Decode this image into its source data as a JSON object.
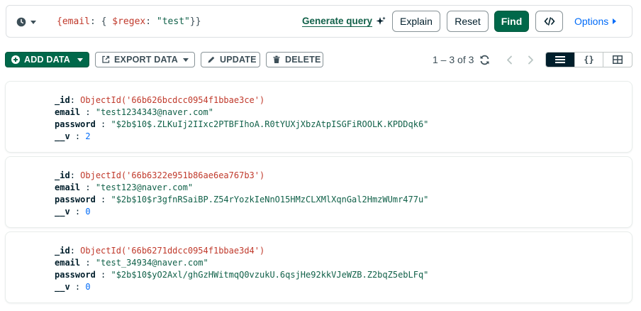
{
  "query": {
    "filter": {
      "open_brace": "{",
      "field": "email",
      "colon": ":",
      "inner_open": " { ",
      "operator": "$regex",
      "colon2": ": ",
      "value": "\"test\"",
      "close": "}}"
    },
    "generate_label": "Generate query",
    "explain_label": "Explain",
    "reset_label": "Reset",
    "find_label": "Find",
    "options_label": "Options"
  },
  "toolbar": {
    "add_label": "ADD DATA",
    "export_label": "EXPORT DATA",
    "update_label": "UPDATE",
    "delete_label": "DELETE",
    "pagination": "1 – 3 of 3"
  },
  "documents": [
    {
      "id_key": "_id",
      "id_value": "ObjectId('66b626bcdcc0954f1bbae3ce')",
      "email_key": "email",
      "email_value": "\"test1234343@naver.com\"",
      "password_key": "password",
      "password_value": "\"$2b$10$.ZLKuIj2IIxc2PTBFIhoA.R0tYUXjXbzAtpISGFiROOLK.KPDDqk6\"",
      "v_key": "__v",
      "v_value": "2"
    },
    {
      "id_key": "_id",
      "id_value": "ObjectId('66b6322e951b86ae6ea767b3')",
      "email_key": "email",
      "email_value": "\"test123@naver.com\"",
      "password_key": "password",
      "password_value": "\"$2b$10$r3gfnRSaiBP.Z54rYozkIeNnO15HMzCLXMlXqnGal2HmzWUmr477u\"",
      "v_key": "__v",
      "v_value": "0"
    },
    {
      "id_key": "_id",
      "id_value": "ObjectId('66b6271ddcc0954f1bbae3d4')",
      "email_key": "email",
      "email_value": "\"test_34934@naver.com\"",
      "password_key": "password",
      "password_value": "\"$2b$10$yO2Axl/ghGzHWitmqQ0vzukU.6qsjHe92kkVJeWZB.Z2bqZ5ebLFq\"",
      "v_key": "__v",
      "v_value": "0"
    }
  ],
  "colors": {
    "primary_green": "#00684a",
    "link_blue": "#016bf8",
    "key_red": "#c0392b",
    "string_green": "#116149",
    "number_blue": "#016bf8"
  },
  "icons": [
    "clock-icon",
    "sparkle-icon",
    "code-icon",
    "plus-circle-icon",
    "export-icon",
    "pencil-icon",
    "trash-icon",
    "refresh-icon",
    "chevron-left-icon",
    "chevron-right-icon",
    "list-view-icon",
    "json-view-icon",
    "table-view-icon"
  ]
}
